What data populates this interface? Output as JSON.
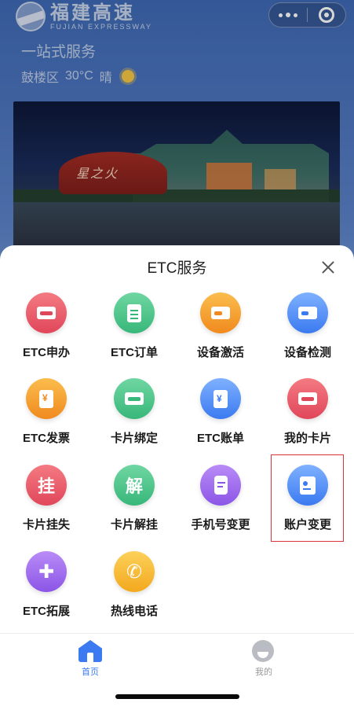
{
  "header": {
    "logo_cn": "福建高速",
    "logo_en": "FUJIAN EXPRESSWAY",
    "subtitle": "一站式服务",
    "weather": {
      "district": "鼓楼区",
      "temperature": "30°C",
      "condition": "晴",
      "icon": "sun-icon"
    },
    "capsule": {
      "more_icon": "more-dots-icon",
      "close_icon": "miniprogram-close-icon"
    }
  },
  "banner": {
    "sign_text": "星之火",
    "description": "service-area night photo"
  },
  "sheet": {
    "title": "ETC服务",
    "close_icon": "close-icon",
    "services": [
      {
        "label": "ETC申办",
        "icon": "etc-card-icon",
        "color": "red"
      },
      {
        "label": "ETC订单",
        "icon": "clipboard-list-icon",
        "color": "green"
      },
      {
        "label": "设备激活",
        "icon": "device-activate-icon",
        "color": "orange"
      },
      {
        "label": "设备检测",
        "icon": "device-check-icon",
        "color": "blue"
      },
      {
        "label": "ETC发票",
        "icon": "invoice-yen-icon",
        "color": "orange"
      },
      {
        "label": "卡片绑定",
        "icon": "card-bind-icon",
        "color": "green"
      },
      {
        "label": "ETC账单",
        "icon": "bill-yen-icon",
        "color": "blue"
      },
      {
        "label": "我的卡片",
        "icon": "etc-card-icon",
        "color": "red"
      },
      {
        "label": "卡片挂失",
        "icon": "report-loss-glyph-icon",
        "color": "red",
        "glyph": "挂"
      },
      {
        "label": "卡片解挂",
        "icon": "unlock-glyph-icon",
        "color": "green",
        "glyph": "解"
      },
      {
        "label": "手机号变更",
        "icon": "phone-change-icon",
        "color": "purple"
      },
      {
        "label": "账户变更",
        "icon": "account-change-icon",
        "color": "blue",
        "highlighted": true
      },
      {
        "label": "ETC拓展",
        "icon": "puzzle-icon",
        "color": "purple"
      },
      {
        "label": "热线电话",
        "icon": "phone-call-icon",
        "color": "yellow"
      }
    ]
  },
  "tabbar": {
    "items": [
      {
        "label": "首页",
        "icon": "home-icon",
        "active": true,
        "color": "#3b7af0"
      },
      {
        "label": "我的",
        "icon": "profile-icon",
        "active": false,
        "color": "#999999"
      }
    ]
  },
  "colors": {
    "accent": "#3b7af0",
    "highlight_border": "#d9343c"
  }
}
